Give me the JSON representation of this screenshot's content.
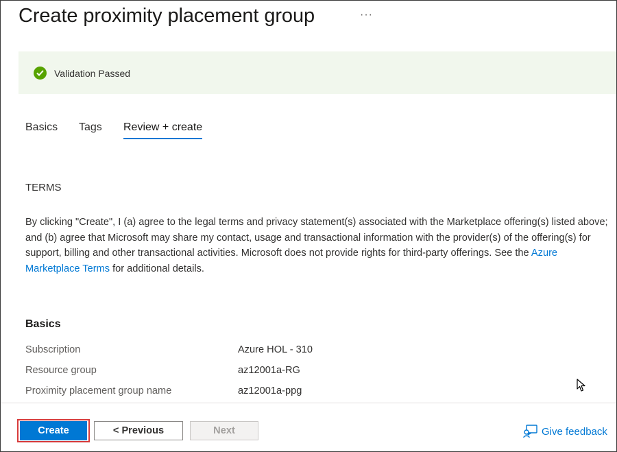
{
  "page": {
    "title": "Create proximity placement group",
    "more_label": "···"
  },
  "validation": {
    "status_text": "Validation Passed",
    "status_color": "#57a300"
  },
  "tabs": [
    {
      "label": "Basics",
      "active": false
    },
    {
      "label": "Tags",
      "active": false
    },
    {
      "label": "Review + create",
      "active": true
    }
  ],
  "terms": {
    "heading": "TERMS",
    "body_before_link": "By clicking \"Create\", I (a) agree to the legal terms and privacy statement(s) associated with the Marketplace offering(s) listed above; and (b) agree that Microsoft may share my contact, usage and transactional information with the provider(s) of the offering(s) for support, billing and other transactional activities. Microsoft does not provide rights for third-party offerings. See the ",
    "link_text": "Azure Marketplace Terms",
    "body_after_link": " for additional details."
  },
  "basics": {
    "heading": "Basics",
    "rows": [
      {
        "key": "Subscription",
        "value": "Azure HOL - 310"
      },
      {
        "key": "Resource group",
        "value": "az12001a-RG"
      },
      {
        "key": "Proximity placement group name",
        "value": "az12001a-ppg"
      }
    ]
  },
  "footer": {
    "create_label": "Create",
    "previous_label": "< Previous",
    "next_label": "Next",
    "feedback_label": "Give feedback"
  },
  "colors": {
    "accent": "#0078d4",
    "highlight_outline": "#d83b3b",
    "banner_bg": "#f1f7ed"
  }
}
